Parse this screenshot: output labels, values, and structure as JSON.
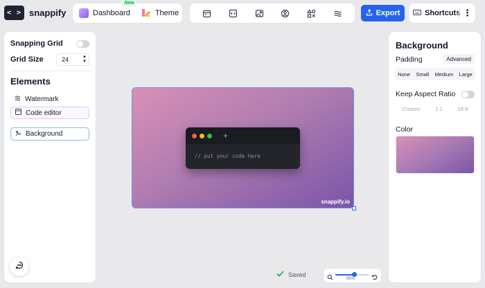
{
  "app": {
    "logo_glyph": "< >",
    "name": "snappify"
  },
  "nav": {
    "dashboard_label": "Dashboard",
    "new_badge": "New",
    "theme_label": "Theme"
  },
  "toolbar": {
    "tools": [
      "calendar-icon",
      "code-block-icon",
      "image-icon",
      "user-icon",
      "shapes-icon",
      "waves-icon"
    ]
  },
  "actions": {
    "export_label": "Export",
    "shortcuts_label": "Shortcuts",
    "more_glyph": "⋮"
  },
  "left_panel": {
    "snapping_grid_label": "Snapping Grid",
    "grid_size_label": "Grid Size",
    "grid_size_value": "24",
    "elements_title": "Elements",
    "elements": [
      {
        "label": "Watermark",
        "icon": "lines-icon"
      },
      {
        "label": "Code editor",
        "icon": "code-window-icon"
      },
      {
        "label": "Background",
        "icon": "background-icon"
      }
    ]
  },
  "canvas": {
    "placeholder": "// put your code here",
    "plus_glyph": "+",
    "watermark": "snappify.io",
    "gradient_start": "#d98fb7",
    "gradient_end": "#7a55a8"
  },
  "status": {
    "saved_label": "Saved",
    "zoom_label": "95%",
    "zoom_fraction": 0.57
  },
  "right_panel": {
    "title": "Background",
    "padding_label": "Padding",
    "advanced_label": "Advanced",
    "padding_options": [
      "None",
      "Small",
      "Medium",
      "Large"
    ],
    "keep_aspect_label": "Keep Aspect Ratio",
    "aspect_options": [
      "Custom",
      "1:1",
      "16:9"
    ],
    "color_label": "Color"
  },
  "colors": {
    "accent": "#2563eb",
    "dot_red": "#ef5b52",
    "dot_yellow": "#f5b82e",
    "dot_green": "#2fc23f"
  }
}
